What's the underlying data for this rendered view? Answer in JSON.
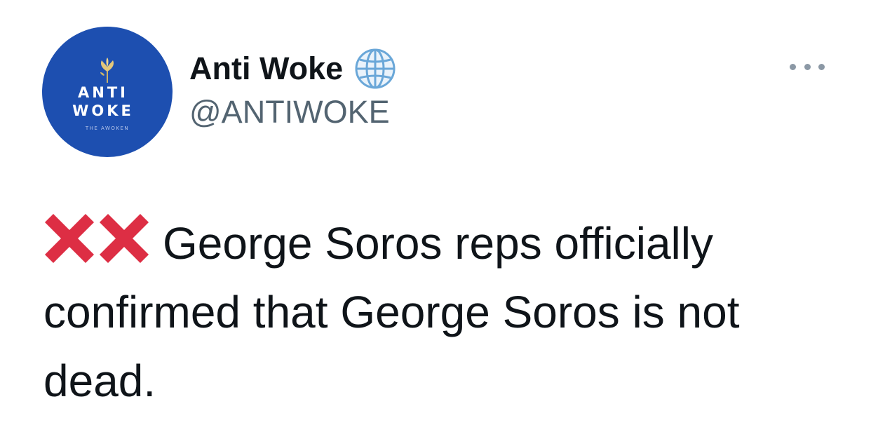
{
  "tweet": {
    "author": {
      "display_name": "Anti Woke",
      "handle": "@ANTIWOKE",
      "verified_icon": "globe-icon",
      "avatar": {
        "line1": "ANTI",
        "line2": "WOKE",
        "tagline": "THE AWOKEN",
        "background_color": "#1d4fb0"
      }
    },
    "menu_icon": "more-icon",
    "body": {
      "prefix_icons": [
        "cross-mark-icon",
        "cross-mark-icon"
      ],
      "text": "George Soros reps officially confirmed that George Soros is not dead."
    }
  },
  "colors": {
    "name": "#0f1419",
    "handle": "#536471",
    "cross": "#dd2e44",
    "globe": "#6aa7d8",
    "more_dots": "#8b98a5"
  }
}
